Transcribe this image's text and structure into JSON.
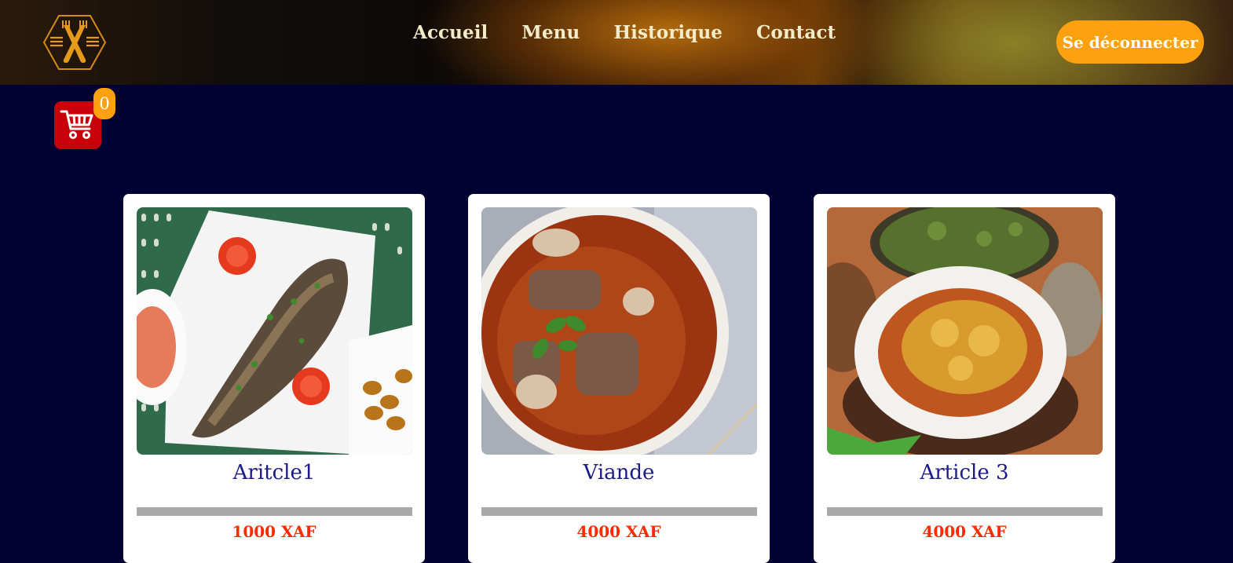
{
  "header": {
    "logo_icon": "fork-knife-hexagon-icon",
    "nav": [
      "Accueil",
      "Menu",
      "Historique",
      "Contact"
    ],
    "logout_label": "Se déconnecter"
  },
  "cart": {
    "icon": "shopping-cart-icon",
    "count": "0"
  },
  "products": [
    {
      "name": "Aritcle1",
      "price": "1000 XAF",
      "image": "grilled-fish-dish"
    },
    {
      "name": "Viande",
      "price": "4000 XAF",
      "image": "meat-stew-bowl"
    },
    {
      "name": "Article 3",
      "price": "4000 XAF",
      "image": "sauce-bowl-with-greens"
    }
  ],
  "colors": {
    "background": "#010134",
    "accent": "#ffa10e",
    "cart": "#c8000a",
    "title": "#1a1a88",
    "price": "#ff2a00"
  }
}
